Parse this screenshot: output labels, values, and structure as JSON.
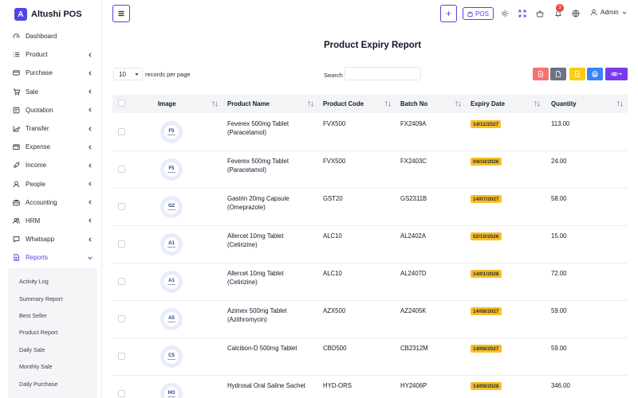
{
  "app": {
    "logo_letter": "A",
    "name": "Altushi POS"
  },
  "sidebar": {
    "items": [
      {
        "label": "Dashboard",
        "icon": "dashboard-icon",
        "chevron": false
      },
      {
        "label": "Product",
        "icon": "list-icon",
        "chevron": true
      },
      {
        "label": "Purchase",
        "icon": "card-icon",
        "chevron": true
      },
      {
        "label": "Sale",
        "icon": "cart-icon",
        "chevron": true
      },
      {
        "label": "Quotation",
        "icon": "quote-icon",
        "chevron": true
      },
      {
        "label": "Transfer",
        "icon": "transfer-icon",
        "chevron": true
      },
      {
        "label": "Expense",
        "icon": "wallet-icon",
        "chevron": true
      },
      {
        "label": "Income",
        "icon": "rocket-icon",
        "chevron": true
      },
      {
        "label": "People",
        "icon": "user-icon",
        "chevron": true
      },
      {
        "label": "Accounting",
        "icon": "briefcase-icon",
        "chevron": true
      },
      {
        "label": "HRM",
        "icon": "users-icon",
        "chevron": true
      },
      {
        "label": "Whatsapp",
        "icon": "chat-icon",
        "chevron": true
      },
      {
        "label": "Reports",
        "icon": "report-icon",
        "chevron": true,
        "expanded": true
      }
    ],
    "report_submenu": [
      "Activity Log",
      "Summary Report",
      "Best Seller",
      "Product Report",
      "Daily Sale",
      "Monthly Sale",
      "Daily Purchase"
    ]
  },
  "header": {
    "plus_label": "+",
    "pos_label": "POS",
    "notification_count": "3",
    "user_name": "Admin"
  },
  "page": {
    "title": "Product Expiry Report",
    "page_length": "10",
    "length_label": "records per page",
    "search_label": "Search",
    "search_value": ""
  },
  "table": {
    "columns": [
      "Image",
      "Product Name",
      "Product Code",
      "Batch No",
      "Expiry Date",
      "Quantity"
    ],
    "rows": [
      {
        "thumb": "F5",
        "name_1": "Feverex 500mg Tablet",
        "name_2": "(Paracetamol)",
        "code": "FVX500",
        "batch": "FX2409A",
        "expiry": "14/11/2027",
        "qty": "113.00"
      },
      {
        "thumb": "F5",
        "name_1": "Feverex 500mg Tablet",
        "name_2": "(Paracetamol)",
        "code": "FVX500",
        "batch": "FX2403C",
        "expiry": "04/10/2026",
        "qty": "24.00"
      },
      {
        "thumb": "G2",
        "name_1": "Gastrin 20mg Capsule",
        "name_2": "(Omeprazole)",
        "code": "GST20",
        "batch": "GS2311B",
        "expiry": "14/07/2027",
        "qty": "58.00"
      },
      {
        "thumb": "A1",
        "name_1": "Allercet 10mg Tablet",
        "name_2": "(Cetirizine)",
        "code": "ALC10",
        "batch": "AL2402A",
        "expiry": "02/10/2026",
        "qty": "15.00"
      },
      {
        "thumb": "A1",
        "name_1": "Allercet 10mg Tablet",
        "name_2": "(Cetirizine)",
        "code": "ALC10",
        "batch": "AL2407D",
        "expiry": "14/01/2028",
        "qty": "72.00"
      },
      {
        "thumb": "A5",
        "name_1": "Azimex 500mg Tablet",
        "name_2": "(Azithromycin)",
        "code": "AZX500",
        "batch": "AZ2405K",
        "expiry": "14/08/2027",
        "qty": "59.00"
      },
      {
        "thumb": "C5",
        "name_1": "Calcibon-D 500mg Tablet",
        "name_2": "",
        "code": "CBD500",
        "batch": "CB2312M",
        "expiry": "14/06/2027",
        "qty": "59.00"
      },
      {
        "thumb": "HO",
        "name_1": "Hydrosal Oral Saline Sachet",
        "name_2": "",
        "code": "HYD-ORS",
        "batch": "HY2406P",
        "expiry": "14/09/2028",
        "qty": "346.00"
      }
    ]
  },
  "colors": {
    "accent": "#4f46e5",
    "expiry_badge": "#fbbf24",
    "badge_red": "#ef4444"
  }
}
